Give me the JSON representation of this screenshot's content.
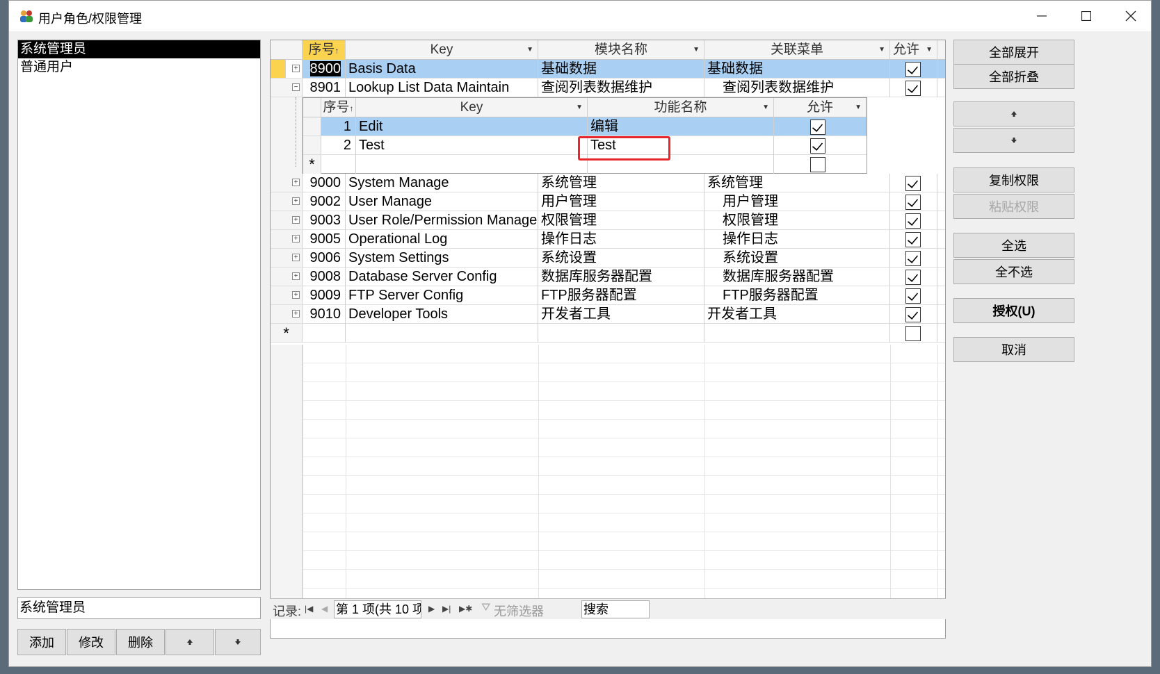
{
  "window": {
    "title": "用户角色/权限管理"
  },
  "roles": {
    "items": [
      "系统管理员",
      "普通用户"
    ],
    "current": "系统管理员"
  },
  "left_buttons": {
    "add": "添加",
    "edit": "修改",
    "delete": "删除"
  },
  "grid": {
    "columns": {
      "seq": "序号",
      "key": "Key",
      "module": "模块名称",
      "menu": "关联菜单",
      "allow": "允许"
    },
    "rows": [
      {
        "seq": "8900",
        "key": "Basis Data",
        "module": "基础数据",
        "menu": "基础数据",
        "allow": true
      },
      {
        "seq": "8901",
        "key": "Lookup List Data Maintain",
        "module": "查阅列表数据维护",
        "menu": "查阅列表数据维护",
        "allow": true
      },
      {
        "seq": "9000",
        "key": "System Manage",
        "module": "系统管理",
        "menu": "系统管理",
        "allow": true
      },
      {
        "seq": "9002",
        "key": "User Manage",
        "module": "用户管理",
        "menu": "用户管理",
        "allow": true
      },
      {
        "seq": "9003",
        "key": "User Role/Permission Manage",
        "module": "权限管理",
        "menu": "权限管理",
        "allow": true
      },
      {
        "seq": "9005",
        "key": "Operational Log",
        "module": "操作日志",
        "menu": "操作日志",
        "allow": true
      },
      {
        "seq": "9006",
        "key": "System Settings",
        "module": "系统设置",
        "menu": "系统设置",
        "allow": true
      },
      {
        "seq": "9008",
        "key": "Database Server Config",
        "module": "数据库服务器配置",
        "menu": "数据库服务器配置",
        "allow": true
      },
      {
        "seq": "9009",
        "key": "FTP Server Config",
        "module": "FTP服务器配置",
        "menu": "FTP服务器配置",
        "allow": true
      },
      {
        "seq": "9010",
        "key": "Developer Tools",
        "module": "开发者工具",
        "menu": "开发者工具",
        "allow": true
      }
    ],
    "new_row_marker": "*"
  },
  "subgrid": {
    "columns": {
      "seq": "序号",
      "key": "Key",
      "func": "功能名称",
      "allow": "允许"
    },
    "rows": [
      {
        "seq": "1",
        "key": "Edit",
        "func": "编辑",
        "allow": true
      },
      {
        "seq": "2",
        "key": "Test",
        "func": "Test",
        "allow": true
      }
    ]
  },
  "navbar": {
    "label": "记录:",
    "position": "第 1 项(共 10 项",
    "filter": "无筛选器",
    "search": "搜索"
  },
  "right_buttons": {
    "expand_all": "全部展开",
    "collapse_all": "全部折叠",
    "copy_perm": "复制权限",
    "paste_perm": "粘贴权限",
    "select_all": "全选",
    "select_none": "全不选",
    "authorize": "授权(U)",
    "cancel": "取消"
  }
}
